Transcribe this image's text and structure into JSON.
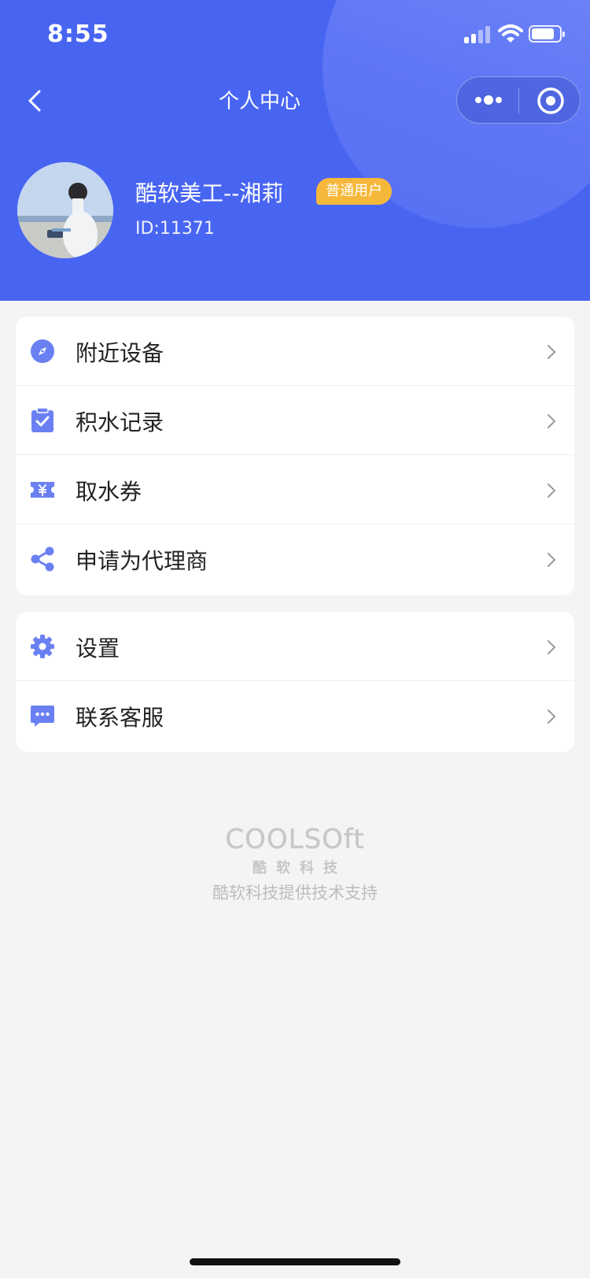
{
  "status_bar": {
    "time": "8:55"
  },
  "nav": {
    "title": "个人中心"
  },
  "user": {
    "name": "酷软美工--湘莉",
    "badge": "普通用户",
    "id_text": "ID:11371"
  },
  "menu_group_1": [
    {
      "label": "附近设备",
      "icon": "compass-icon"
    },
    {
      "label": "积水记录",
      "icon": "clipboard-check-icon"
    },
    {
      "label": "取水券",
      "icon": "ticket-yen-icon"
    },
    {
      "label": "申请为代理商",
      "icon": "share-icon"
    }
  ],
  "menu_group_2": [
    {
      "label": "设置",
      "icon": "gear-icon"
    },
    {
      "label": "联系客服",
      "icon": "chat-icon"
    }
  ],
  "footer": {
    "logo": "COOLSOft",
    "logo_sub": "酷软科技",
    "support_text": "酷软科技提供技术支持"
  },
  "colors": {
    "header_bg": "#4865f2",
    "icon": "#6a80f2",
    "badge": "#f6b83a"
  }
}
